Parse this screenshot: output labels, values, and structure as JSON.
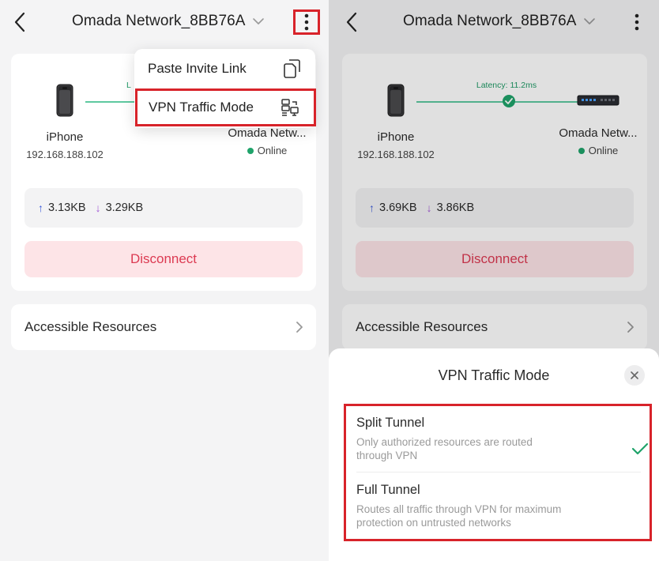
{
  "colors": {
    "accent_green": "#1fa36a",
    "disconnect_text": "#dc3a52",
    "disconnect_bg": "#fde4e7",
    "highlight_red": "#d8232a",
    "upload_arrow": "#3b5bd9",
    "download_arrow": "#a35bd6"
  },
  "left": {
    "header": {
      "title": "Omada Network_8BB76A"
    },
    "menu": {
      "items": [
        {
          "label": "Paste Invite Link",
          "icon": "paste-icon"
        },
        {
          "label": "VPN Traffic Mode",
          "icon": "traffic-mode-icon"
        }
      ]
    },
    "connection": {
      "client": {
        "name": "iPhone",
        "ip": "192.168.188.102",
        "icon": "phone-icon"
      },
      "gateway": {
        "name": "Omada Netw...",
        "status": "Online",
        "icon": "router-icon"
      },
      "latency_partial": "L"
    },
    "traffic": {
      "up_arrow": "↑",
      "up": "3.13KB",
      "down_arrow": "↓",
      "down": "3.29KB"
    },
    "disconnect_label": "Disconnect",
    "resources_label": "Accessible Resources"
  },
  "right": {
    "header": {
      "title": "Omada Network_8BB76A"
    },
    "connection": {
      "client": {
        "name": "iPhone",
        "ip": "192.168.188.102",
        "icon": "phone-icon"
      },
      "gateway": {
        "name": "Omada Netw...",
        "status": "Online",
        "icon": "router-icon"
      },
      "latency": "Latency: 11.2ms"
    },
    "traffic": {
      "up_arrow": "↑",
      "up": "3.69KB",
      "down_arrow": "↓",
      "down": "3.86KB"
    },
    "disconnect_label": "Disconnect",
    "resources_label": "Accessible Resources",
    "sheet": {
      "title": "VPN Traffic Mode",
      "options": [
        {
          "title": "Split Tunnel",
          "description": "Only authorized resources are routed through VPN",
          "selected": true
        },
        {
          "title": "Full Tunnel",
          "description": "Routes all traffic through VPN for maximum protection on untrusted networks",
          "selected": false
        }
      ]
    }
  }
}
